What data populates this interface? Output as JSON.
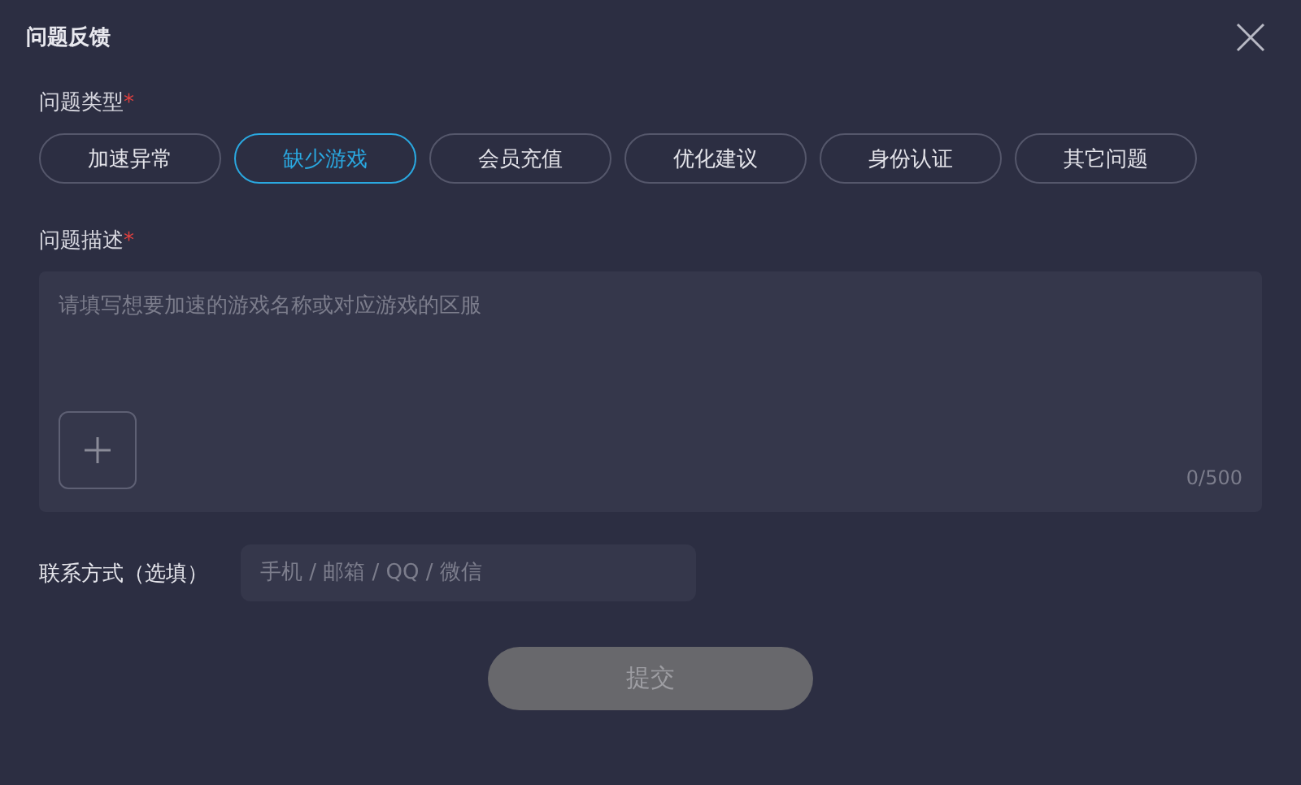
{
  "window": {
    "title": "问题反馈"
  },
  "type_section": {
    "label": "问题类型",
    "required_mark": "*"
  },
  "types": [
    {
      "label": "加速异常",
      "selected": false
    },
    {
      "label": "缺少游戏",
      "selected": true
    },
    {
      "label": "会员充值",
      "selected": false
    },
    {
      "label": "优化建议",
      "selected": false
    },
    {
      "label": "身份认证",
      "selected": false
    },
    {
      "label": "其它问题",
      "selected": false
    }
  ],
  "description": {
    "label": "问题描述",
    "required_mark": "*",
    "placeholder": "请填写想要加速的游戏名称或对应游戏的区服",
    "counter": "0/500"
  },
  "contact": {
    "label": "联系方式（选填）",
    "placeholder": "手机 / 邮箱 / QQ / 微信"
  },
  "submit": {
    "label": "提交",
    "disabled": true
  }
}
